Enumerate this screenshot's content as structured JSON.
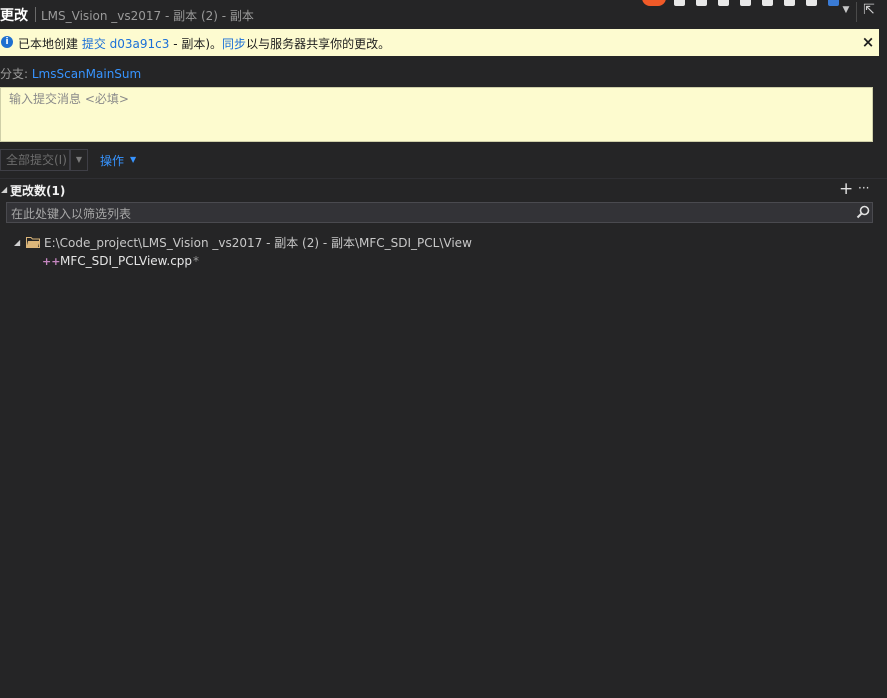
{
  "header": {
    "title": "更改",
    "subtitle": "LMS_Vision _vs2017 - 副本 (2) - 副本",
    "dropdown_icon": "chevron-down-icon",
    "pin_icon": "pop-out-icon"
  },
  "info_bar": {
    "prefix": "已本地创建 ",
    "commit_link": "提交 d03a91c3",
    "middle": " - 副本)。",
    "sync_link": "同步",
    "suffix": "以与服务器共享你的更改。",
    "close": "×",
    "icon": "info-icon",
    "background": "#fdfbd0"
  },
  "branch": {
    "label": "分支: ",
    "name": "LmsScanMainSum"
  },
  "commit_message": {
    "placeholder": "输入提交消息 <必填>",
    "value": ""
  },
  "commit_button": {
    "label": "全部提交(I)",
    "dropdown_icon": "chevron-down-icon"
  },
  "actions_menu": {
    "label": "操作",
    "caret_icon": "caret-down-icon"
  },
  "changes": {
    "title": "更改数(1)",
    "add_icon": "plus-icon",
    "more_icon": "ellipsis-icon",
    "filter_placeholder": "在此处键入以筛选列表",
    "search_icon": "search-icon"
  },
  "tree": {
    "folder_path": "E:\\Code_project\\LMS_Vision _vs2017 - 副本 (2) - 副本\\MFC_SDI_PCL\\View",
    "folder_icon": "folder-icon",
    "files": [
      {
        "name": "MFC_SDI_PCLView.cpp",
        "status_icon": "added-file-icon",
        "modified_mark": "*"
      }
    ]
  },
  "colors": {
    "background": "#252526",
    "link": "#3794ff",
    "input_yellow": "#fdfbcf"
  }
}
